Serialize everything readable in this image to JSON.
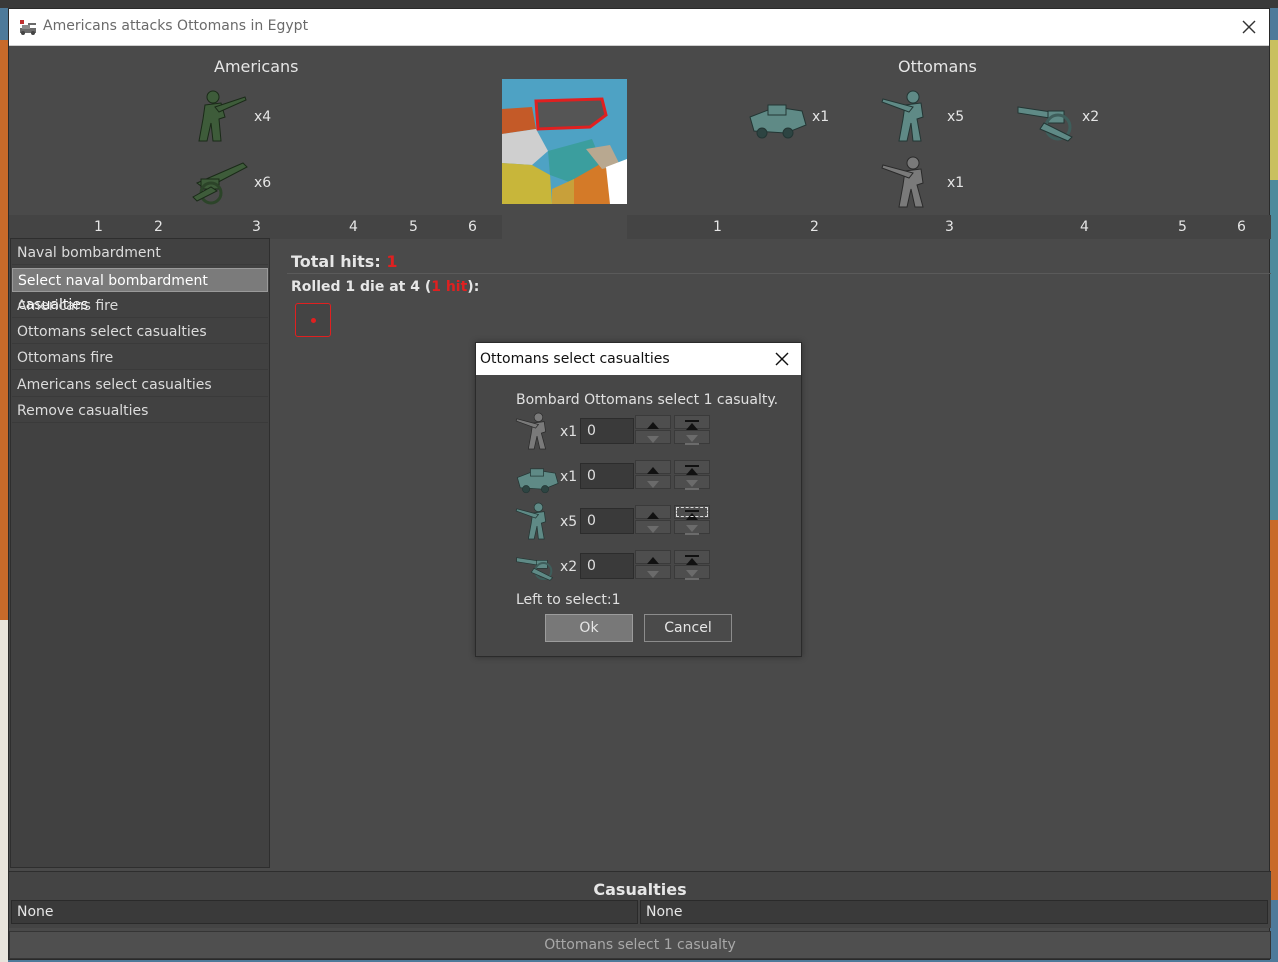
{
  "window": {
    "title": "Americans attacks Ottomans in Egypt"
  },
  "attacker": {
    "name": "Americans",
    "units": [
      {
        "icon": "infantry-icon",
        "count": "x4"
      },
      {
        "icon": "artillery-icon",
        "count": "x6"
      }
    ]
  },
  "defender": {
    "name": "Ottomans",
    "units": [
      {
        "icon": "armour-icon",
        "count": "x1"
      },
      {
        "icon": "infantry-icon",
        "count": "x5"
      },
      {
        "icon": "artillery-icon",
        "count": "x2"
      },
      {
        "icon": "marine-icon",
        "count": "x1"
      }
    ]
  },
  "dice_ticks_left": [
    "1",
    "2",
    "3",
    "4",
    "5",
    "6"
  ],
  "dice_ticks_right": [
    "1",
    "2",
    "3",
    "4",
    "5",
    "6"
  ],
  "steps": [
    "Naval bombardment",
    "Select naval bombardment casualties",
    "Americans fire",
    "Ottomans select casualties",
    "Ottomans fire",
    "Americans select casualties",
    "Remove casualties"
  ],
  "selected_step": 1,
  "results": {
    "total_hits_label": "Total hits:",
    "total_hits_value": "1",
    "roll_prefix": "Rolled 1 die at 4 (",
    "roll_hits": "1 hit",
    "roll_suffix": "):"
  },
  "casualties": {
    "title": "Casualties",
    "left": "None",
    "right": "None"
  },
  "status": "Ottomans select 1 casualty",
  "dialog": {
    "title": "Ottomans select casualties",
    "message": "Bombard Ottomans select 1 casualty.",
    "rows": [
      {
        "icon": "marine-icon",
        "count": "x1",
        "value": "0"
      },
      {
        "icon": "armour-icon",
        "count": "x1",
        "value": "0"
      },
      {
        "icon": "infantry-icon",
        "count": "x5",
        "value": "0"
      },
      {
        "icon": "artillery-icon",
        "count": "x2",
        "value": "0"
      }
    ],
    "left_to_select": "Left to select:1",
    "ok_label": "Ok",
    "cancel_label": "Cancel"
  },
  "colors": {
    "background": "#4a4a4a",
    "accent_red": "#e02020",
    "american_unit": "#3e5c3a",
    "ottoman_unit": "#5f8a86"
  }
}
